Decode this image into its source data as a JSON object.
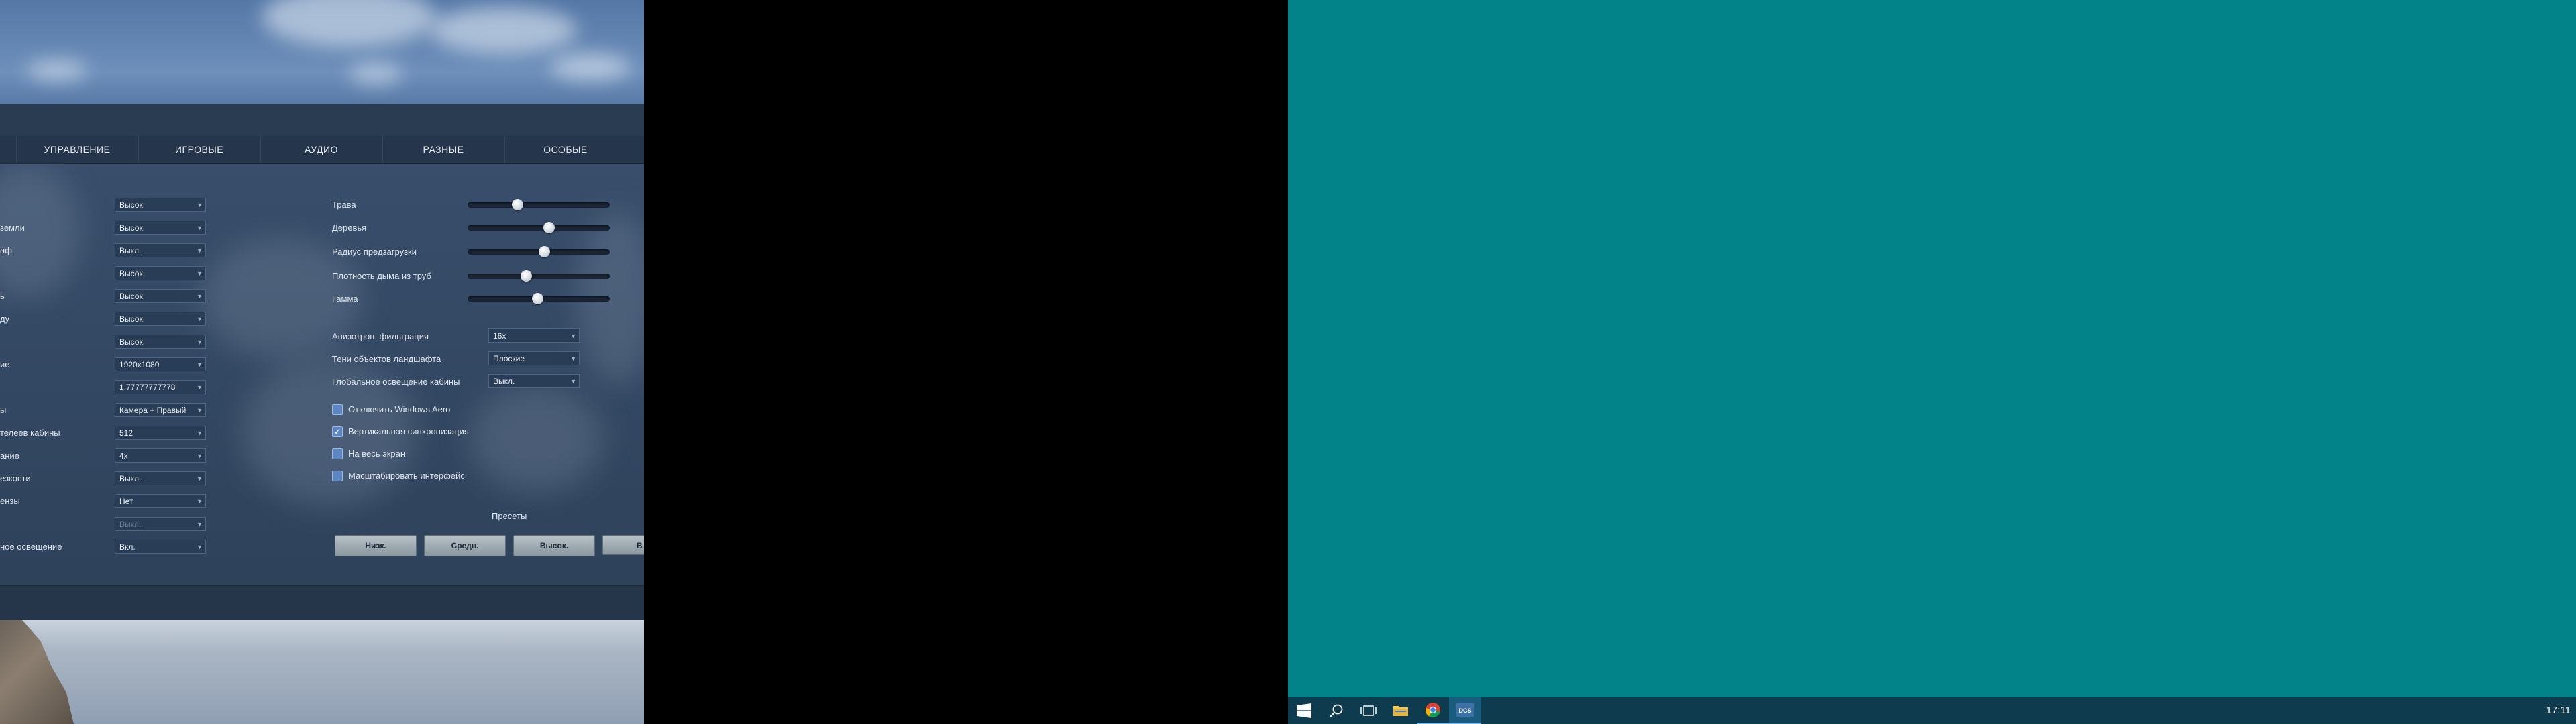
{
  "tabs": [
    "УПРАВЛЕНИЕ",
    "ИГРОВЫЕ",
    "АУДИО",
    "РАЗНЫЕ",
    "ОСОБЫЕ"
  ],
  "left_rows": [
    {
      "label": "",
      "value": "Высок.",
      "disabled": false
    },
    {
      "label": "земли",
      "value": "Высок.",
      "disabled": false
    },
    {
      "label": "аф.",
      "value": "Выкл.",
      "disabled": false
    },
    {
      "label": "",
      "value": "Высок.",
      "disabled": false
    },
    {
      "label": "ь",
      "value": "Высок.",
      "disabled": false
    },
    {
      "label": "ду",
      "value": "Высок.",
      "disabled": false
    },
    {
      "label": "",
      "value": "Высок.",
      "disabled": false
    },
    {
      "label": "ие",
      "value": "1920x1080",
      "disabled": false
    },
    {
      "label": "",
      "value": "1.77777777778",
      "disabled": false
    },
    {
      "label": "ы",
      "value": "Камера + Правый",
      "disabled": false
    },
    {
      "label": "телеев кабины",
      "value": "512",
      "disabled": false
    },
    {
      "label": "ание",
      "value": "4x",
      "disabled": false
    },
    {
      "label": "езкости",
      "value": "Выкл.",
      "disabled": false
    },
    {
      "label": "ензы",
      "value": "Нет",
      "disabled": false
    },
    {
      "label": "",
      "value": "Выкл.",
      "disabled": true
    },
    {
      "label": "ное освещение",
      "value": "Вкл.",
      "disabled": false
    }
  ],
  "sliders": [
    {
      "label": "Трава",
      "value": 0.35
    },
    {
      "label": "Деревья",
      "value": 0.57
    },
    {
      "label": "Радиус предзагрузки",
      "value": 0.54
    },
    {
      "label": "Плотность дыма из труб",
      "value": 0.41
    },
    {
      "label": "Гамма",
      "value": 0.49
    }
  ],
  "right_dropdowns": [
    {
      "label": "Анизотроп. фильтрация",
      "value": "16x"
    },
    {
      "label": "Тени объектов ландшафта",
      "value": "Плоские"
    },
    {
      "label": "Глобальное освещение кабины",
      "value": "Выкл."
    }
  ],
  "checkboxes": [
    {
      "label": "Отключить Windows Aero",
      "checked": false
    },
    {
      "label": "Вертикальная синхронизация",
      "checked": true
    },
    {
      "label": "На весь экран",
      "checked": false
    },
    {
      "label": "Масштабировать интерфейс",
      "checked": false
    }
  ],
  "presets": {
    "title": "Пресеты",
    "buttons": [
      "Низк.",
      "Средн.",
      "Высок.",
      "В"
    ]
  },
  "taskbar": {
    "clock": "17:11",
    "dcs_label": "DCS"
  },
  "icons": {
    "start": "windows-start-icon",
    "search": "search-icon",
    "taskview": "task-view-icon",
    "explorer": "folder-icon",
    "chrome": "chrome-icon",
    "dcs": "dcs-app-icon"
  },
  "colors": {
    "desktop_bg": "#02838a",
    "taskbar_bg": "#0f3b4e",
    "checkbox_fill": "#5c86c2"
  }
}
